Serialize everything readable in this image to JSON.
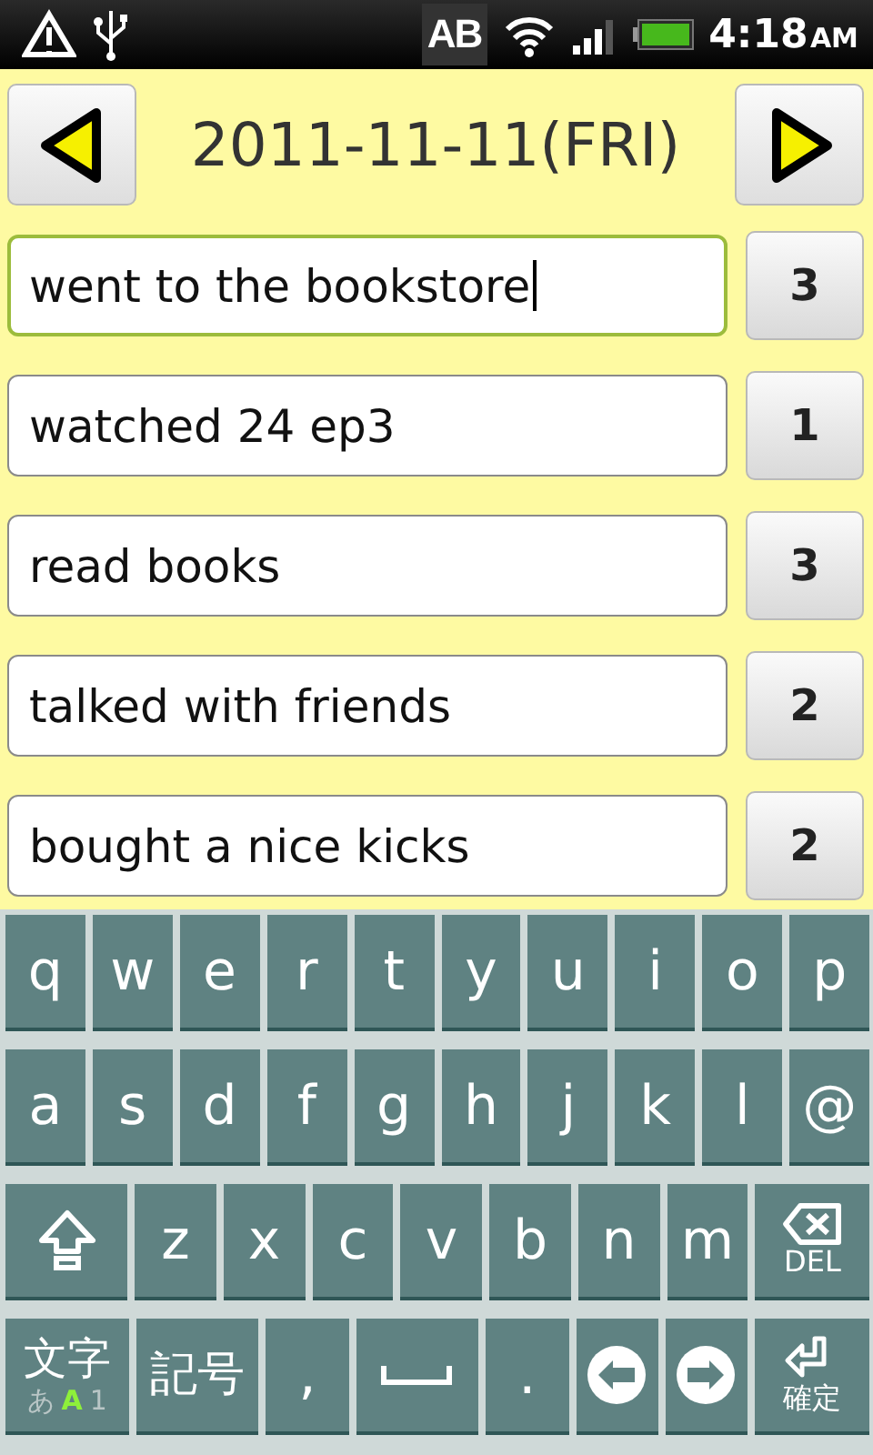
{
  "status_bar": {
    "input_mode": "AB",
    "time": "4:18",
    "ampm": "AM"
  },
  "header": {
    "date": "2011-11-11(FRI)"
  },
  "entries": [
    {
      "text": "went to the bookstore",
      "count": "3",
      "focused": true
    },
    {
      "text": "watched 24 ep3",
      "count": "1",
      "focused": false
    },
    {
      "text": "read books",
      "count": "3",
      "focused": false
    },
    {
      "text": "talked with friends",
      "count": "2",
      "focused": false
    },
    {
      "text": "bought a nice kicks",
      "count": "2",
      "focused": false
    }
  ],
  "keyboard": {
    "rows": [
      {
        "keys": [
          {
            "kind": "char",
            "label": "q"
          },
          {
            "kind": "char",
            "label": "w"
          },
          {
            "kind": "char",
            "label": "e"
          },
          {
            "kind": "char",
            "label": "r"
          },
          {
            "kind": "char",
            "label": "t"
          },
          {
            "kind": "char",
            "label": "y"
          },
          {
            "kind": "char",
            "label": "u"
          },
          {
            "kind": "char",
            "label": "i"
          },
          {
            "kind": "char",
            "label": "o"
          },
          {
            "kind": "char",
            "label": "p"
          }
        ]
      },
      {
        "keys": [
          {
            "kind": "char",
            "label": "a"
          },
          {
            "kind": "char",
            "label": "s"
          },
          {
            "kind": "char",
            "label": "d"
          },
          {
            "kind": "char",
            "label": "f"
          },
          {
            "kind": "char",
            "label": "g"
          },
          {
            "kind": "char",
            "label": "h"
          },
          {
            "kind": "char",
            "label": "j"
          },
          {
            "kind": "char",
            "label": "k"
          },
          {
            "kind": "char",
            "label": "l"
          },
          {
            "kind": "char",
            "label": "@"
          }
        ]
      },
      {
        "keys": [
          {
            "kind": "shift"
          },
          {
            "kind": "char",
            "label": "z"
          },
          {
            "kind": "char",
            "label": "x"
          },
          {
            "kind": "char",
            "label": "c"
          },
          {
            "kind": "char",
            "label": "v"
          },
          {
            "kind": "char",
            "label": "b"
          },
          {
            "kind": "char",
            "label": "n"
          },
          {
            "kind": "char",
            "label": "m"
          },
          {
            "kind": "del",
            "label": "DEL"
          }
        ]
      },
      {
        "keys": [
          {
            "kind": "mode",
            "label": "文字",
            "options": [
              {
                "label": "あ",
                "selected": false
              },
              {
                "label": "A",
                "selected": true
              },
              {
                "label": "1",
                "selected": false
              }
            ]
          },
          {
            "kind": "symbol",
            "label": "記号"
          },
          {
            "kind": "char",
            "label": ","
          },
          {
            "kind": "space"
          },
          {
            "kind": "char",
            "label": "."
          },
          {
            "kind": "left"
          },
          {
            "kind": "right"
          },
          {
            "kind": "enter",
            "label": "確定"
          }
        ]
      }
    ]
  }
}
